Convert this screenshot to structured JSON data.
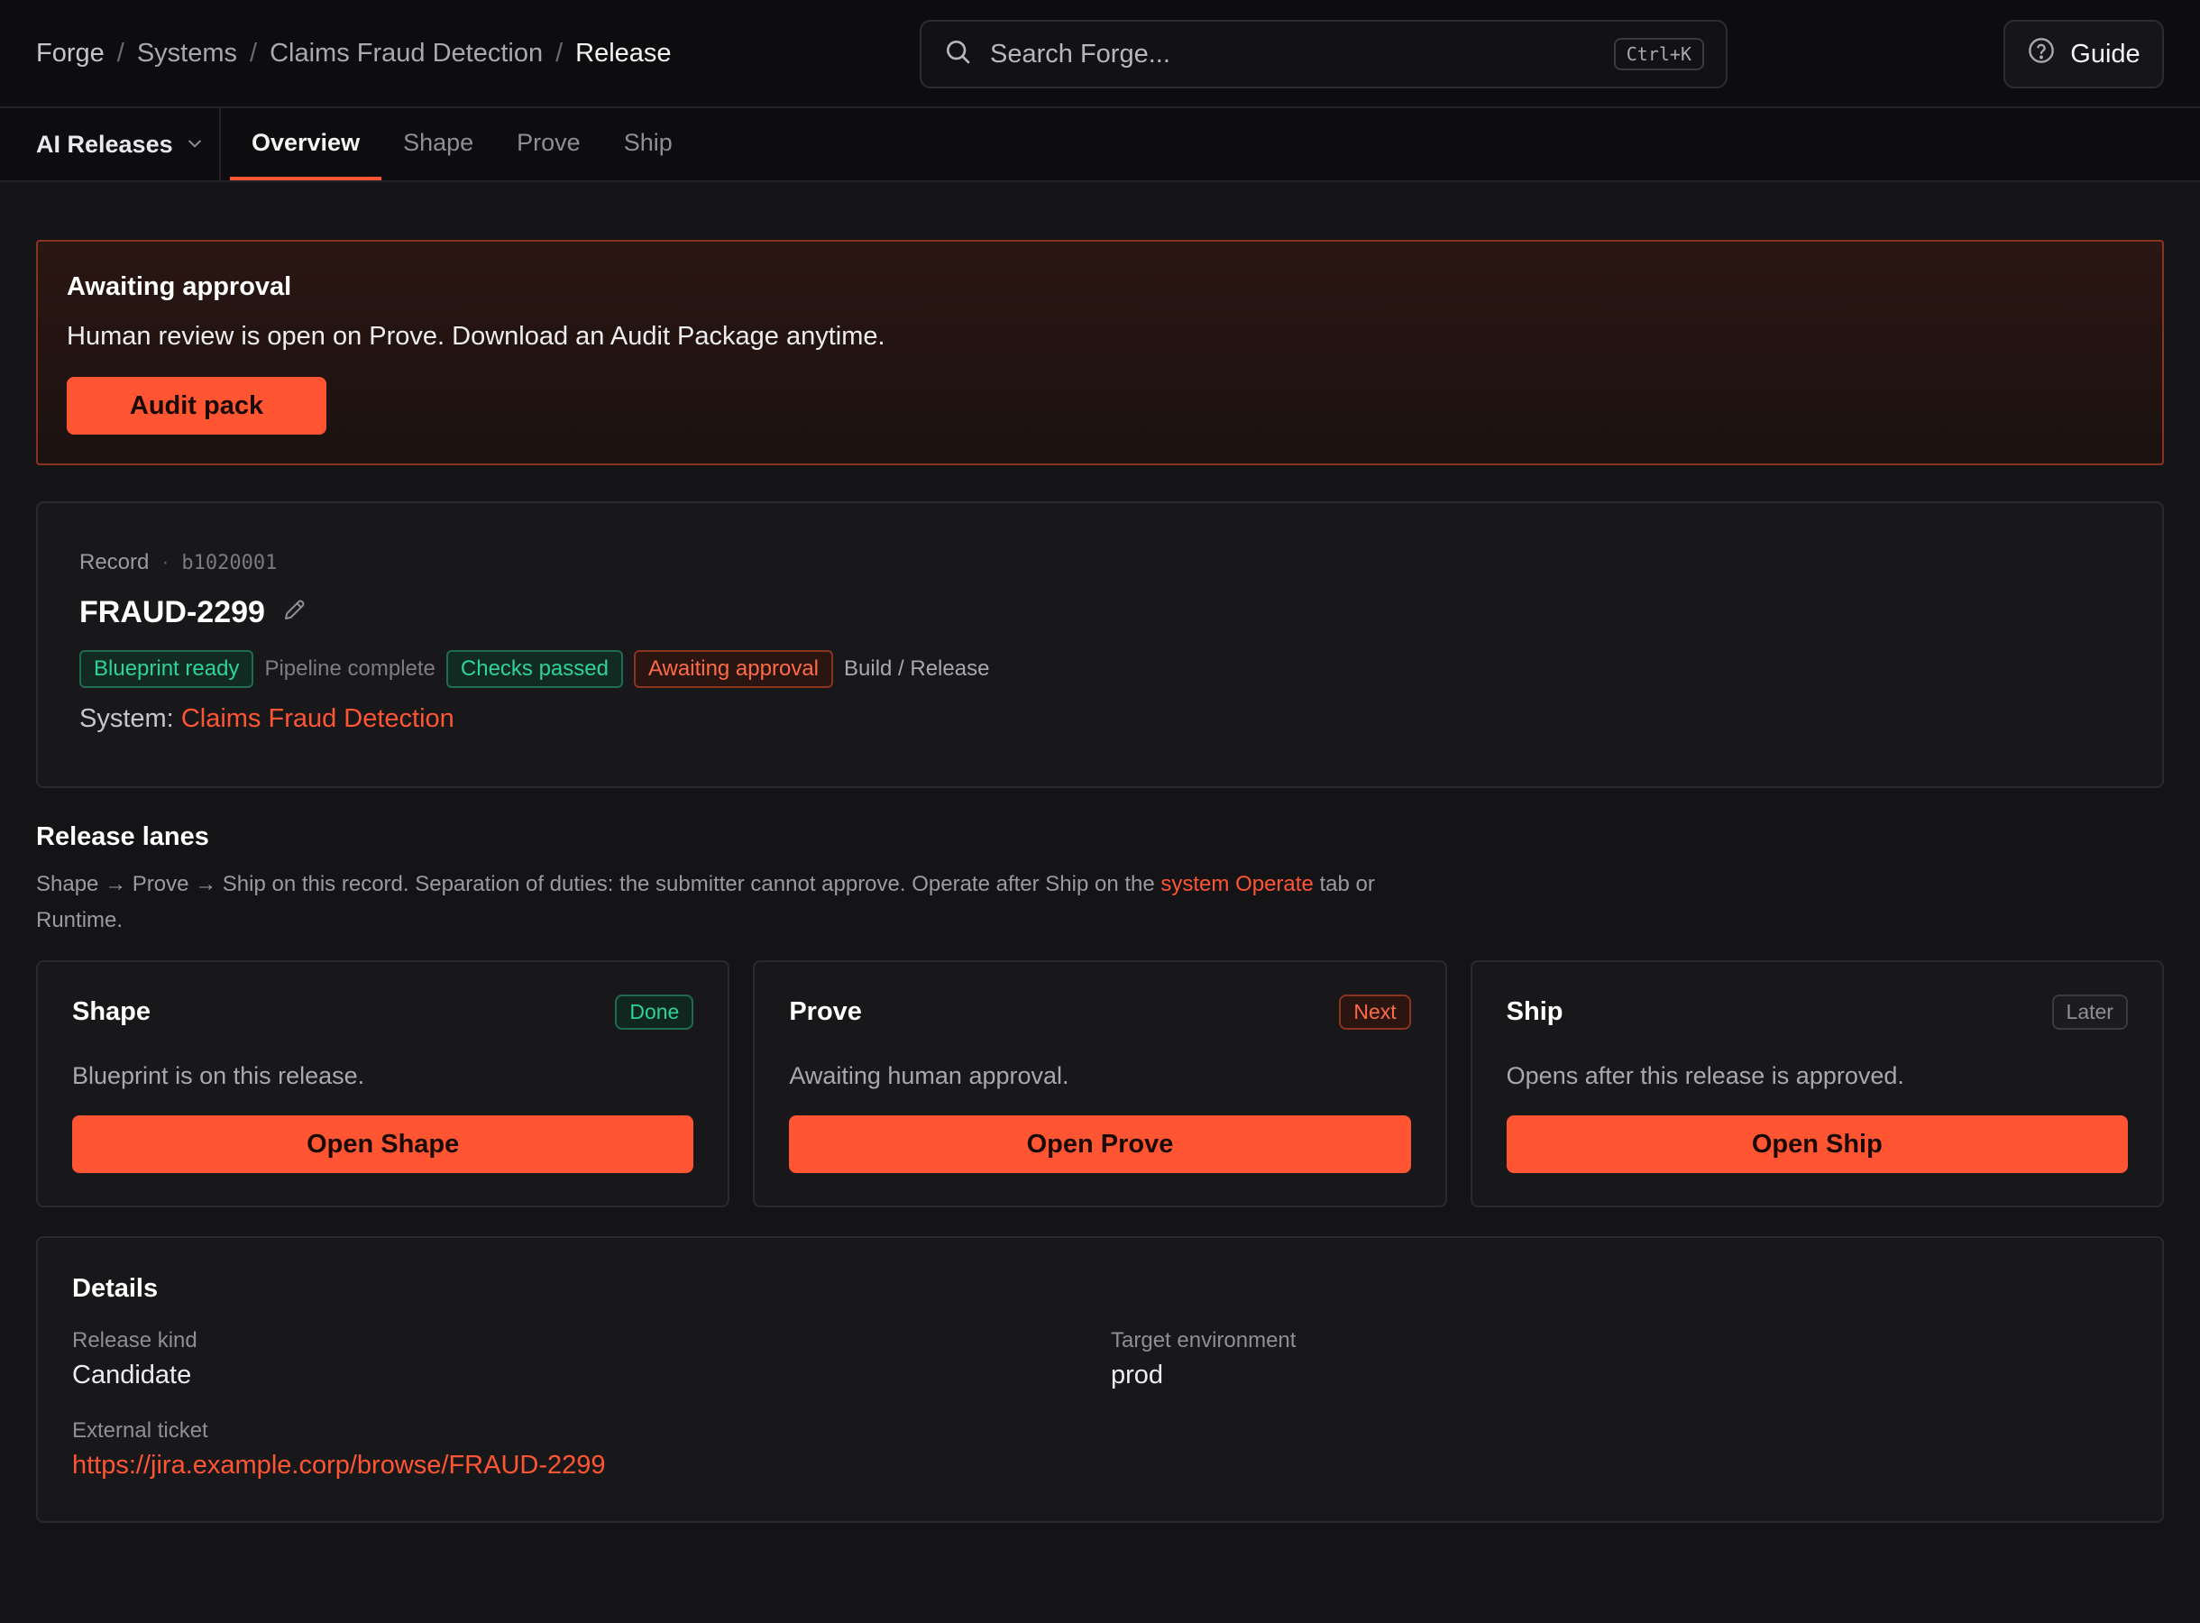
{
  "breadcrumb": [
    "Forge",
    "Systems",
    "Claims Fraud Detection",
    "Release"
  ],
  "breadcrumb_sep": "/",
  "search": {
    "placeholder": "Search Forge...",
    "shortcut": "Ctrl+K"
  },
  "guide_label": "Guide",
  "subnav": {
    "switcher": "AI Releases",
    "tabs": [
      "Overview",
      "Shape",
      "Prove",
      "Ship"
    ],
    "active_tab": "Overview"
  },
  "alert": {
    "title": "Awaiting approval",
    "body": "Human review is open on Prove. Download an Audit Package anytime.",
    "button": "Audit pack"
  },
  "record": {
    "label": "Record",
    "dot": "·",
    "id": "b1020001",
    "title": "FRAUD-2299",
    "badges": {
      "blueprint": "Blueprint ready",
      "pipeline": "Pipeline complete",
      "checks": "Checks passed",
      "approval": "Awaiting approval",
      "kind": "Build / Release"
    },
    "system_label": "System:",
    "system_name": "Claims Fraud Detection"
  },
  "lanes_section": {
    "title": "Release lanes",
    "desc_before": "Shape → Prove → Ship on this record. Separation of duties: the submitter cannot approve. Operate after Ship on the ",
    "desc_link": "system Operate",
    "desc_after": " tab or Runtime.",
    "lanes": [
      {
        "title": "Shape",
        "status": "Done",
        "desc": "Blueprint is on this release.",
        "button": "Open Shape"
      },
      {
        "title": "Prove",
        "status": "Next",
        "desc": "Awaiting human approval.",
        "button": "Open Prove"
      },
      {
        "title": "Ship",
        "status": "Later",
        "desc": "Opens after this release is approved.",
        "button": "Open Ship"
      }
    ]
  },
  "details": {
    "title": "Details",
    "release_kind_label": "Release kind",
    "release_kind": "Candidate",
    "target_env_label": "Target environment",
    "target_env": "prod",
    "ticket_label": "External ticket",
    "ticket_url": "https://jira.example.corp/browse/FRAUD-2299"
  },
  "colors": {
    "accent": "#ff5533",
    "success": "#2fd39a",
    "background": "#141417"
  }
}
